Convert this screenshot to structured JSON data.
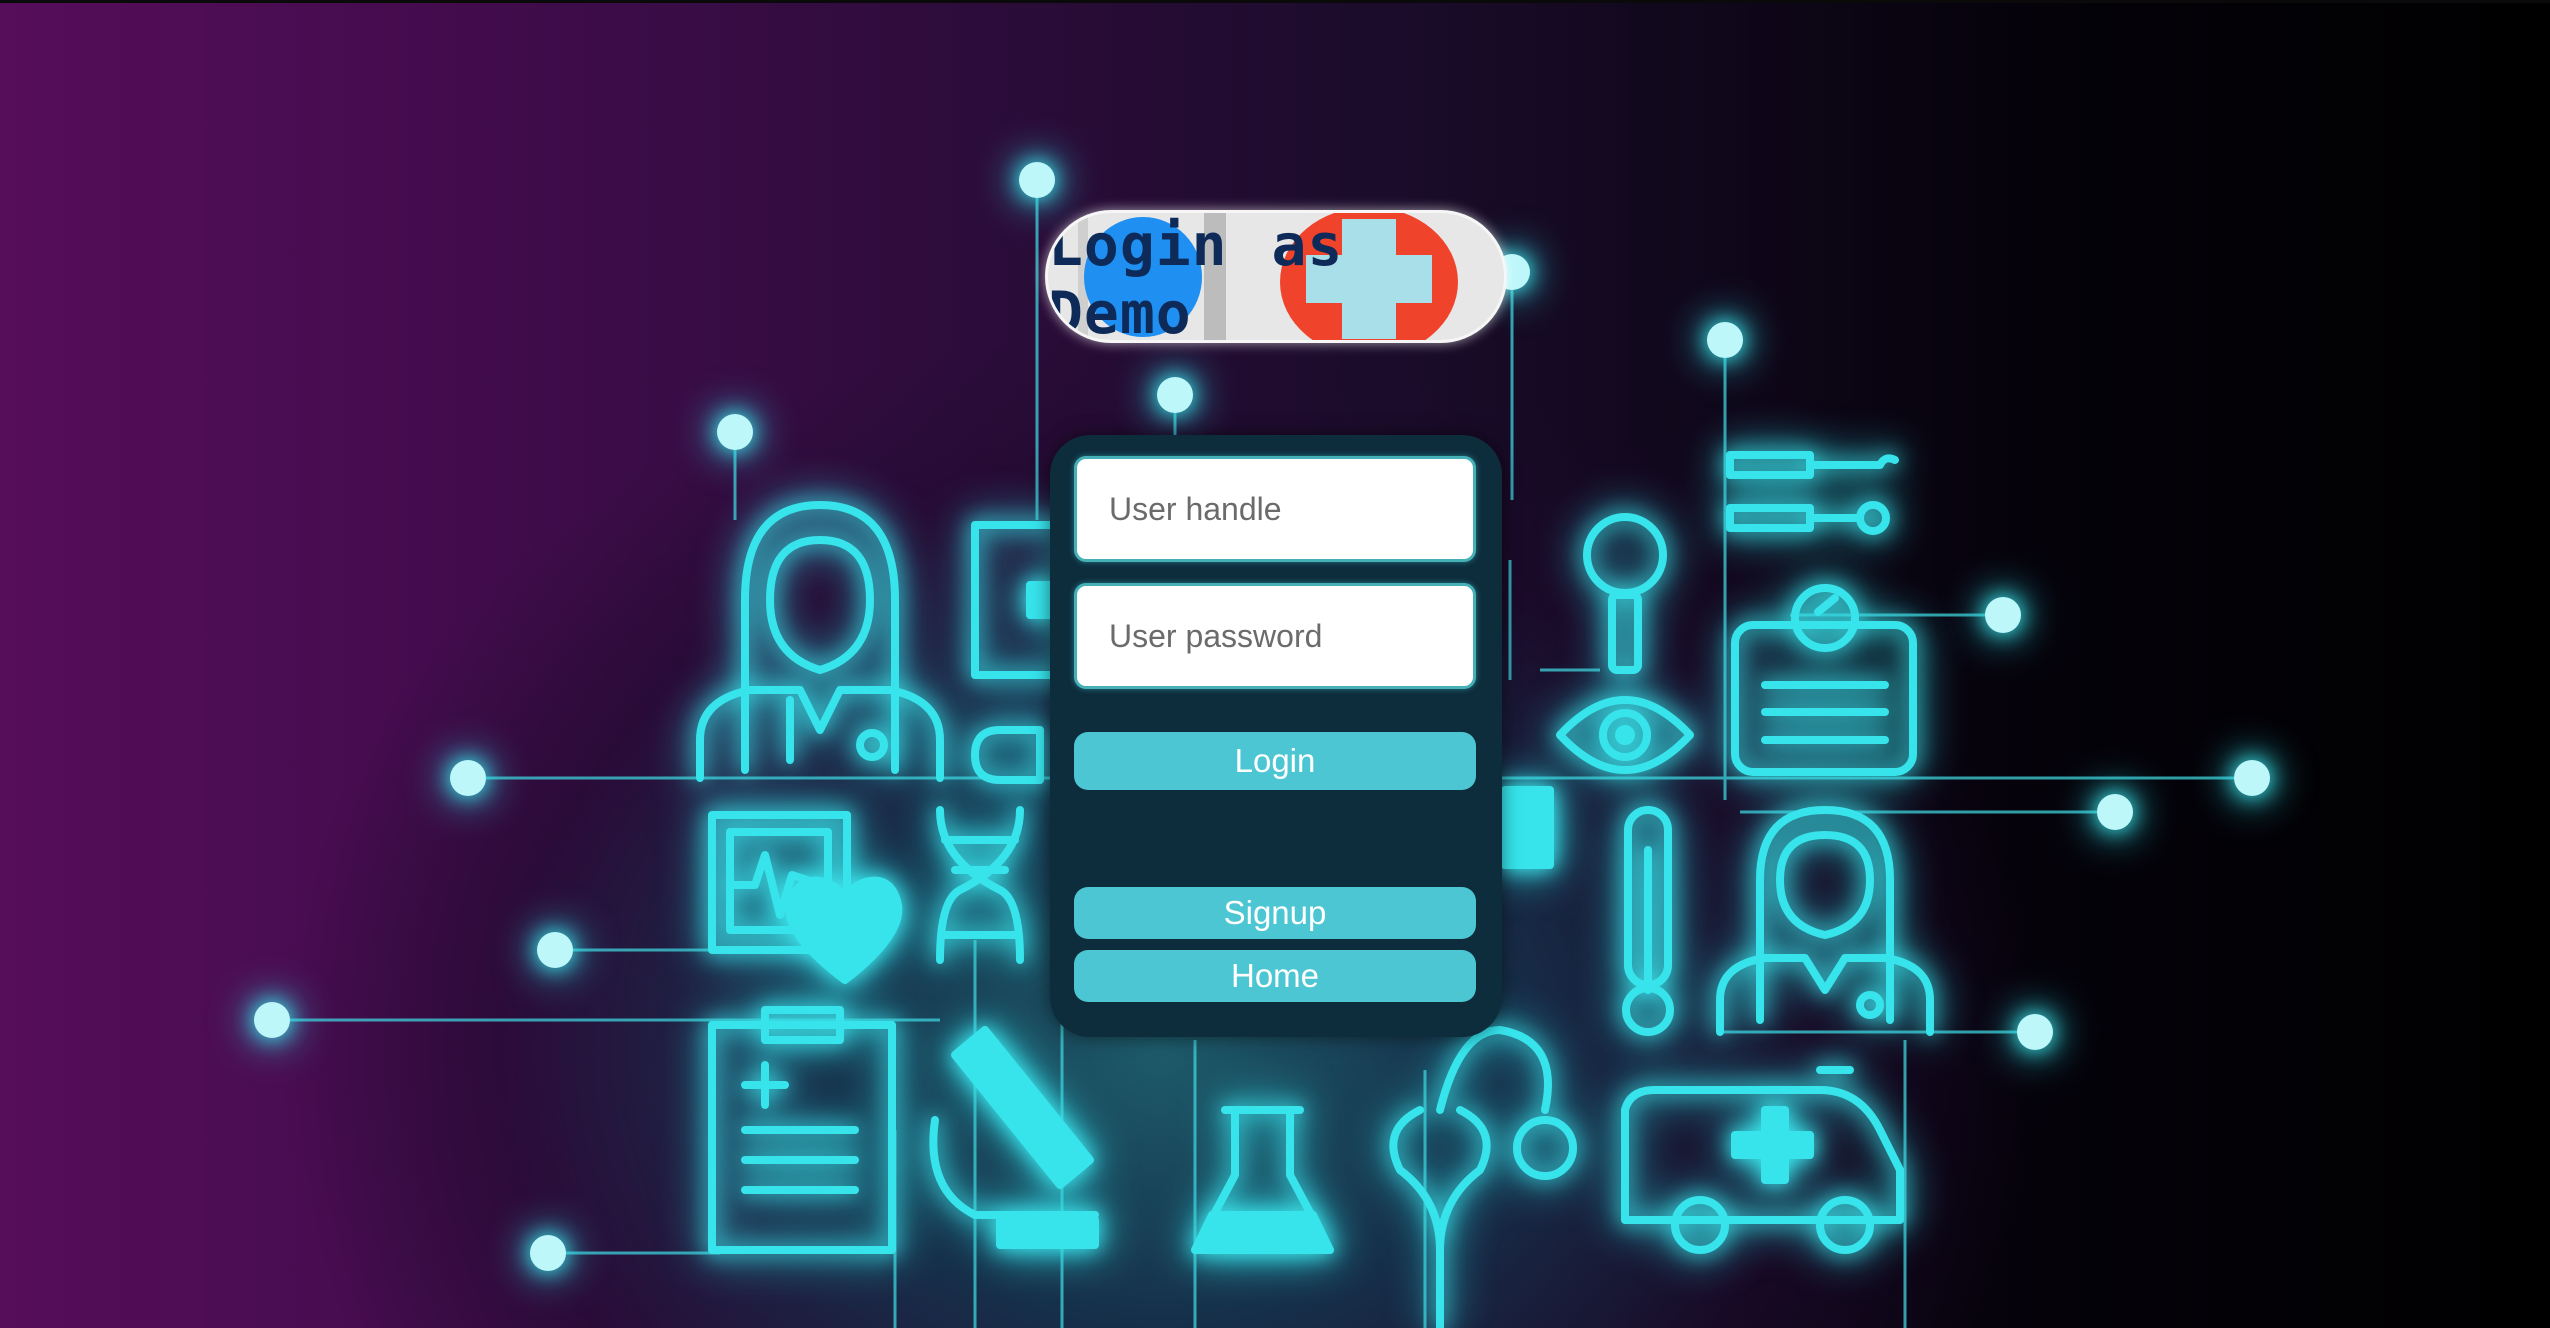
{
  "demo": {
    "label": "Login as Demo"
  },
  "login_form": {
    "handle_placeholder": "User handle",
    "password_placeholder": "User password",
    "login_label": "Login",
    "signup_label": "Signup",
    "home_label": "Home"
  },
  "theme": {
    "accent": "#4cc6d2",
    "panel": "#0d2d3d",
    "neon": "#3fe7ee",
    "bg_left": "#560d5a",
    "bg_right": "#000000"
  },
  "background_icons": [
    "doctor-icon",
    "medical-kit-icon",
    "magnifier-icon",
    "id-badge-icon",
    "eye-icon",
    "heart-monitor-icon",
    "heart-icon",
    "dna-icon",
    "thermometer-icon",
    "clipboard-icon",
    "microscope-icon",
    "flask-icon",
    "stethoscope-icon",
    "ambulance-icon"
  ]
}
